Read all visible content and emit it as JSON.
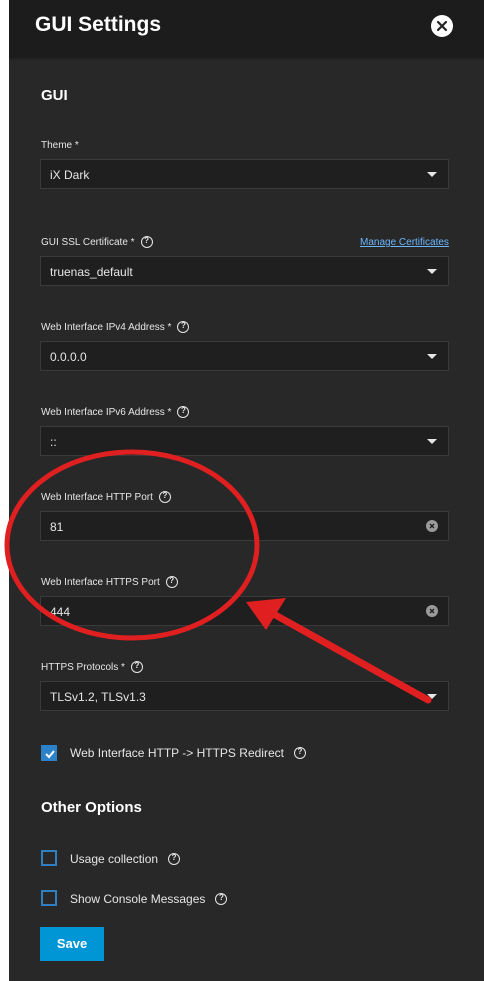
{
  "header": {
    "title": "GUI Settings"
  },
  "sections": {
    "gui_title": "GUI",
    "other_title": "Other Options"
  },
  "fields": {
    "theme": {
      "label": "Theme *",
      "value": "iX Dark"
    },
    "ssl_cert": {
      "label": "GUI SSL Certificate *",
      "value": "truenas_default",
      "link": "Manage Certificates"
    },
    "ipv4": {
      "label": "Web Interface IPv4 Address *",
      "value": "0.0.0.0"
    },
    "ipv6": {
      "label": "Web Interface IPv6 Address *",
      "value": "::"
    },
    "http_port": {
      "label": "Web Interface HTTP Port",
      "value": "81"
    },
    "https_port": {
      "label": "Web Interface HTTPS Port",
      "value": "444"
    },
    "https_protocols": {
      "label": "HTTPS Protocols *",
      "value": "TLSv1.2, TLSv1.3"
    }
  },
  "checkboxes": {
    "redirect": {
      "label": "Web Interface HTTP -> HTTPS Redirect",
      "checked": true
    },
    "usage": {
      "label": "Usage collection",
      "checked": false
    },
    "console": {
      "label": "Show Console Messages",
      "checked": false
    }
  },
  "actions": {
    "save_label": "Save"
  },
  "colors": {
    "panel_bg": "#282828",
    "header_bg": "#1c1c1c",
    "accent": "#0095d5",
    "annotation": "#e02020"
  },
  "icons": {
    "close": "close-icon",
    "help": "help-icon",
    "clear": "clear-icon",
    "dropdown": "chevron-down-icon"
  }
}
